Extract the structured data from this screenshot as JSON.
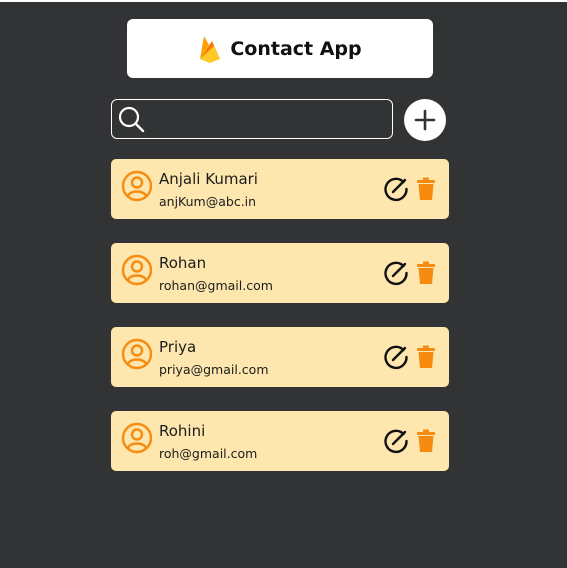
{
  "header": {
    "logo_icon": "firebase-icon",
    "title": "Contact App"
  },
  "search": {
    "icon": "search-icon",
    "value": "",
    "placeholder": ""
  },
  "add_button": {
    "icon": "plus-icon"
  },
  "colors": {
    "background": "#323334",
    "card": "#fde7ae",
    "accent": "#f78b0f",
    "header_bg": "#ffffff"
  },
  "contacts": [
    {
      "name": "Anjali Kumari",
      "email": "anjKum@abc.in"
    },
    {
      "name": "Rohan",
      "email": "rohan@gmail.com"
    },
    {
      "name": "Priya",
      "email": "priya@gmail.com"
    },
    {
      "name": "Rohini",
      "email": "roh@gmail.com"
    }
  ]
}
